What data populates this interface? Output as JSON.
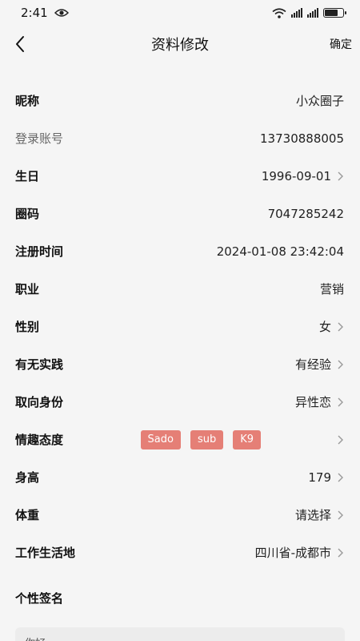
{
  "status": {
    "time": "2:41"
  },
  "nav": {
    "title": "资料修改",
    "confirm": "确定"
  },
  "rows": [
    {
      "label": "昵称",
      "value": "小众圈子"
    },
    {
      "label": "登录账号",
      "value": "13730888005"
    },
    {
      "label": "生日",
      "value": "1996-09-01"
    },
    {
      "label": "圈码",
      "value": "7047285242"
    },
    {
      "label": "注册时间",
      "value": "2024-01-08 23:42:04"
    },
    {
      "label": "职业",
      "value": "营销"
    },
    {
      "label": "性别",
      "value": "女"
    },
    {
      "label": "有无实践",
      "value": "有经验"
    },
    {
      "label": "取向身份",
      "value": "异性恋"
    },
    {
      "label": "情趣态度",
      "tags": [
        "Sado",
        "sub",
        "K9"
      ]
    },
    {
      "label": "身高",
      "value": "179"
    },
    {
      "label": "体重",
      "value": "请选择"
    },
    {
      "label": "工作生活地",
      "value": "四川省-成都市"
    }
  ],
  "signature": {
    "label": "个性签名",
    "value": "你好"
  },
  "colors": {
    "tag_bg": "#e57f76",
    "page_bg": "#f5f5f5"
  }
}
